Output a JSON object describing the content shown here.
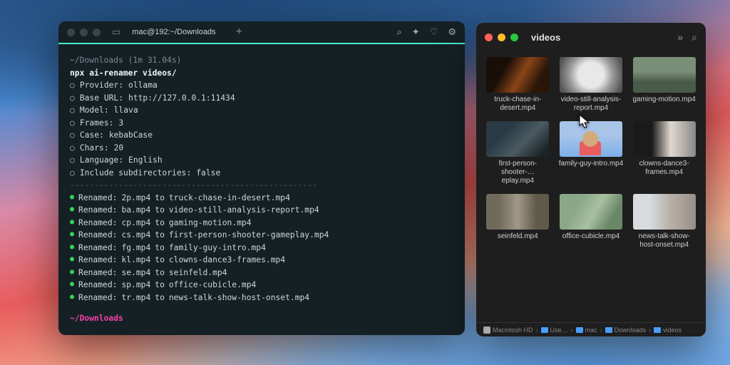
{
  "terminal": {
    "tab_title": "mac@192:~/Downloads",
    "timer_line": "~/Downloads (1m 31.04s)",
    "command": "npx ai-renamer videos/",
    "settings": [
      {
        "key": "Provider",
        "val": "ollama"
      },
      {
        "key": "Base URL",
        "val": "http://127.0.0.1:11434"
      },
      {
        "key": "Model",
        "val": "llava"
      },
      {
        "key": "Frames",
        "val": "3"
      },
      {
        "key": "Case",
        "val": "kebabCase"
      },
      {
        "key": "Chars",
        "val": "20"
      },
      {
        "key": "Language",
        "val": "English"
      },
      {
        "key": "Include subdirectories",
        "val": "false"
      }
    ],
    "renames": [
      {
        "old": "2p.mp4",
        "new": "truck-chase-in-desert.mp4"
      },
      {
        "old": "ba.mp4",
        "new": "video-still-analysis-report.mp4"
      },
      {
        "old": "cp.mp4",
        "new": "gaming-motion.mp4"
      },
      {
        "old": "cs.mp4",
        "new": "first-person-shooter-gameplay.mp4"
      },
      {
        "old": "fg.mp4",
        "new": "family-guy-intro.mp4"
      },
      {
        "old": "kl.mp4",
        "new": "clowns-dance3-frames.mp4"
      },
      {
        "old": "se.mp4",
        "new": "seinfeld.mp4"
      },
      {
        "old": "sp.mp4",
        "new": "office-cubicle.mp4"
      },
      {
        "old": "tr.mp4",
        "new": "news-talk-show-host-onset.mp4"
      }
    ],
    "renamed_label": "Renamed:",
    "to_label": "to",
    "prompt": "~/Downloads",
    "divider": "---------------------------------------------------"
  },
  "finder": {
    "title": "videos",
    "files": [
      {
        "name": "truck-chase-in-desert.mp4",
        "thumb": "t1"
      },
      {
        "name": "video-still-analysis-report.mp4",
        "thumb": "t2"
      },
      {
        "name": "gaming-motion.mp4",
        "thumb": "t3"
      },
      {
        "name": "first-person-shooter-…eplay.mp4",
        "thumb": "t4"
      },
      {
        "name": "family-guy-intro.mp4",
        "thumb": "t5"
      },
      {
        "name": "clowns-dance3-frames.mp4",
        "thumb": "t6"
      },
      {
        "name": "seinfeld.mp4",
        "thumb": "t7"
      },
      {
        "name": "office-cubicle.mp4",
        "thumb": "t8"
      },
      {
        "name": "news-talk-show-host-onset.mp4",
        "thumb": "t9"
      }
    ],
    "path": [
      "Macintosh HD",
      "Use…",
      "mac",
      "Downloads",
      "videos"
    ]
  }
}
